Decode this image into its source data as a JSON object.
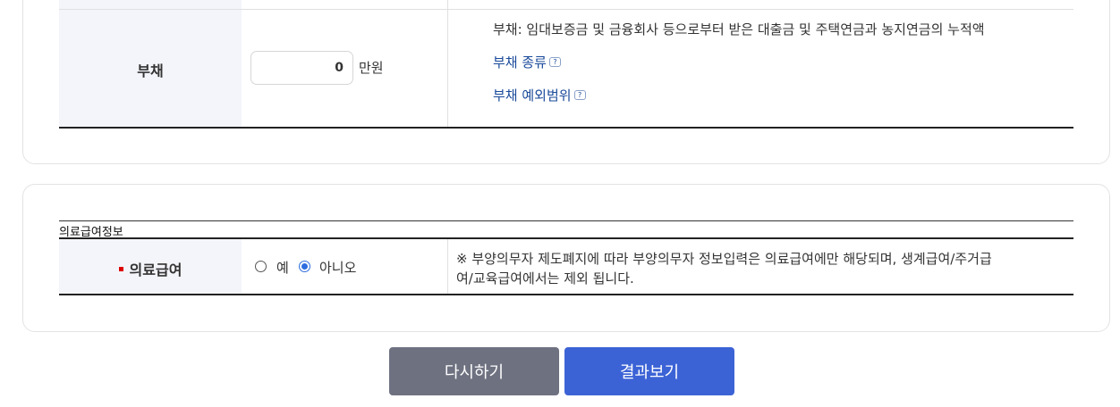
{
  "debt_row": {
    "label": "부채",
    "input_value": "0",
    "unit": "만원",
    "description": "부채: 임대보증금 및 금융회사 등으로부터 받은 대출금 및 주택연금과 농지연금의 누적액",
    "link_types": "부채 종류",
    "link_exceptions": "부채 예외범위",
    "help_icon_text": "?"
  },
  "medical_section": {
    "title": "의료급여정보",
    "row_label": "의료급여",
    "options": [
      {
        "label": "예",
        "checked": false
      },
      {
        "label": "아니오",
        "checked": true
      }
    ],
    "note_line1": "※ 부양의무자 제도폐지에 따라 부양의무자 정보입력은 의료급여에만 해당되며, 생계급여/주거급",
    "note_line2": "여/교육급여에서는 제외 됩니다."
  },
  "buttons": {
    "reset_label": "다시하기",
    "result_label": "결과보기"
  },
  "colors": {
    "header_bg": "#f4f5fa",
    "link": "#1a4a9a",
    "required": "#dd0000",
    "reset_button": "#6e7180",
    "result_button": "#3c63d6"
  }
}
